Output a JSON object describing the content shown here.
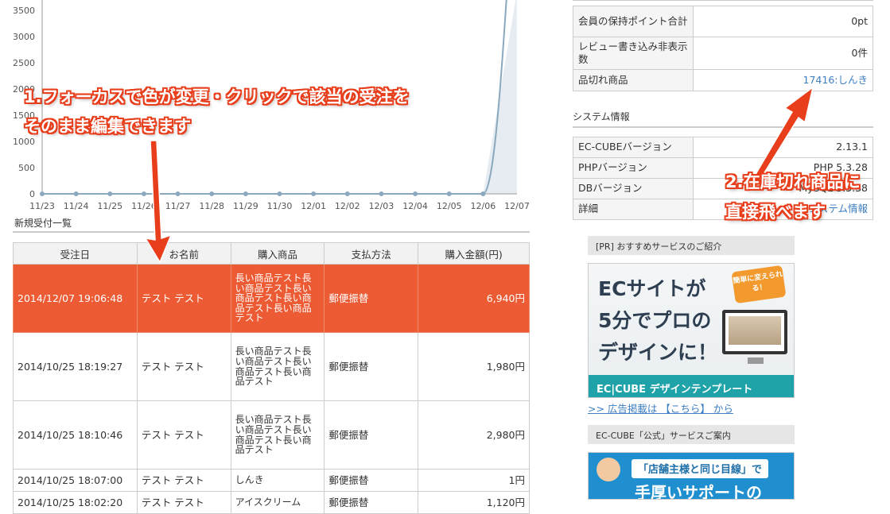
{
  "chart_data": {
    "type": "line",
    "categories": [
      "11/23",
      "11/24",
      "11/25",
      "11/26",
      "11/27",
      "11/28",
      "11/29",
      "11/30",
      "12/01",
      "12/02",
      "12/03",
      "12/04",
      "12/05",
      "12/06",
      "12/07"
    ],
    "values": [
      0,
      0,
      0,
      0,
      0,
      0,
      0,
      0,
      0,
      0,
      0,
      0,
      0,
      0,
      6940
    ],
    "y_ticks": [
      "0",
      "500",
      "1000",
      "1500",
      "2000",
      "2500",
      "3000",
      "3500"
    ],
    "ylim": [
      0,
      3700
    ],
    "colors": {
      "line": "#8aa9bf",
      "area": "#e6ecf2"
    }
  },
  "orders": {
    "title": "新規受付一覧",
    "headers": [
      "受注日",
      "お名前",
      "購入商品",
      "支払方法",
      "購入金額(円)"
    ],
    "rows": [
      {
        "date": "2014/12/07 19:06:48",
        "name": "テスト テスト",
        "items": "長い商品テスト長い商品テスト長い商品テスト長い商品テスト長い商品テスト",
        "payment": "郵便振替",
        "amount": "6,940円",
        "active": true
      },
      {
        "date": "2014/10/25 18:19:27",
        "name": "テスト テスト",
        "items": "長い商品テスト長い商品テスト長い商品テスト長い商品テスト",
        "payment": "郵便振替",
        "amount": "1,980円"
      },
      {
        "date": "2014/10/25 18:10:46",
        "name": "テスト テスト",
        "items": "長い商品テスト長い商品テスト長い商品テスト長い商品テスト",
        "payment": "郵便振替",
        "amount": "2,980円"
      },
      {
        "date": "2014/10/25 18:07:00",
        "name": "テスト テスト",
        "items": "しんき",
        "payment": "郵便振替",
        "amount": "1円"
      },
      {
        "date": "2014/10/25 18:02:20",
        "name": "テスト テスト",
        "items": "アイスクリーム",
        "payment": "郵便振替",
        "amount": "1,120円"
      }
    ],
    "active_color": "#ec5b33"
  },
  "shop_info": {
    "rows": [
      {
        "key": "会員の保持ポイント合計",
        "value": "0pt"
      },
      {
        "key": "レビュー書き込み非表示数",
        "value": "0件"
      },
      {
        "key": "品切れ商品",
        "value": "17416:しんき",
        "link": true
      }
    ]
  },
  "system_info": {
    "title": "システム情報",
    "rows": [
      {
        "key": "EC-CUBEバージョン",
        "value": "2.13.1"
      },
      {
        "key": "PHPバージョン",
        "value": "PHP 5.3.28"
      },
      {
        "key": "DBバージョン",
        "value": "MySQL 5.5.38"
      },
      {
        "key": "詳細",
        "value": "システム情報",
        "link": true
      }
    ]
  },
  "ads": {
    "pr_title": "[PR] おすすめサービスのご紹介",
    "banner1": {
      "line1": "ECサイトが",
      "line2": "5分でプロの",
      "line3": "デザインに！",
      "badge": "簡単に変えられる！",
      "footer": "EC|CUBE デザインテンプレート"
    },
    "ad_link": ">> 広告掲載は 【こちら】 から",
    "official_title": "EC-CUBE「公式」サービスご案内",
    "banner2": {
      "line1": "「店舗主様と同じ目線」で",
      "line2": "手厚いサポートの"
    }
  },
  "annotations": {
    "a1_line1": "1.フォーカスで色が変更・クリックで該当の受注を",
    "a1_line2": "そのまま編集できます",
    "a2_line1": "2.在庫切れ商品に",
    "a2_line2": "直接飛べます",
    "color": "#e83e1b"
  }
}
